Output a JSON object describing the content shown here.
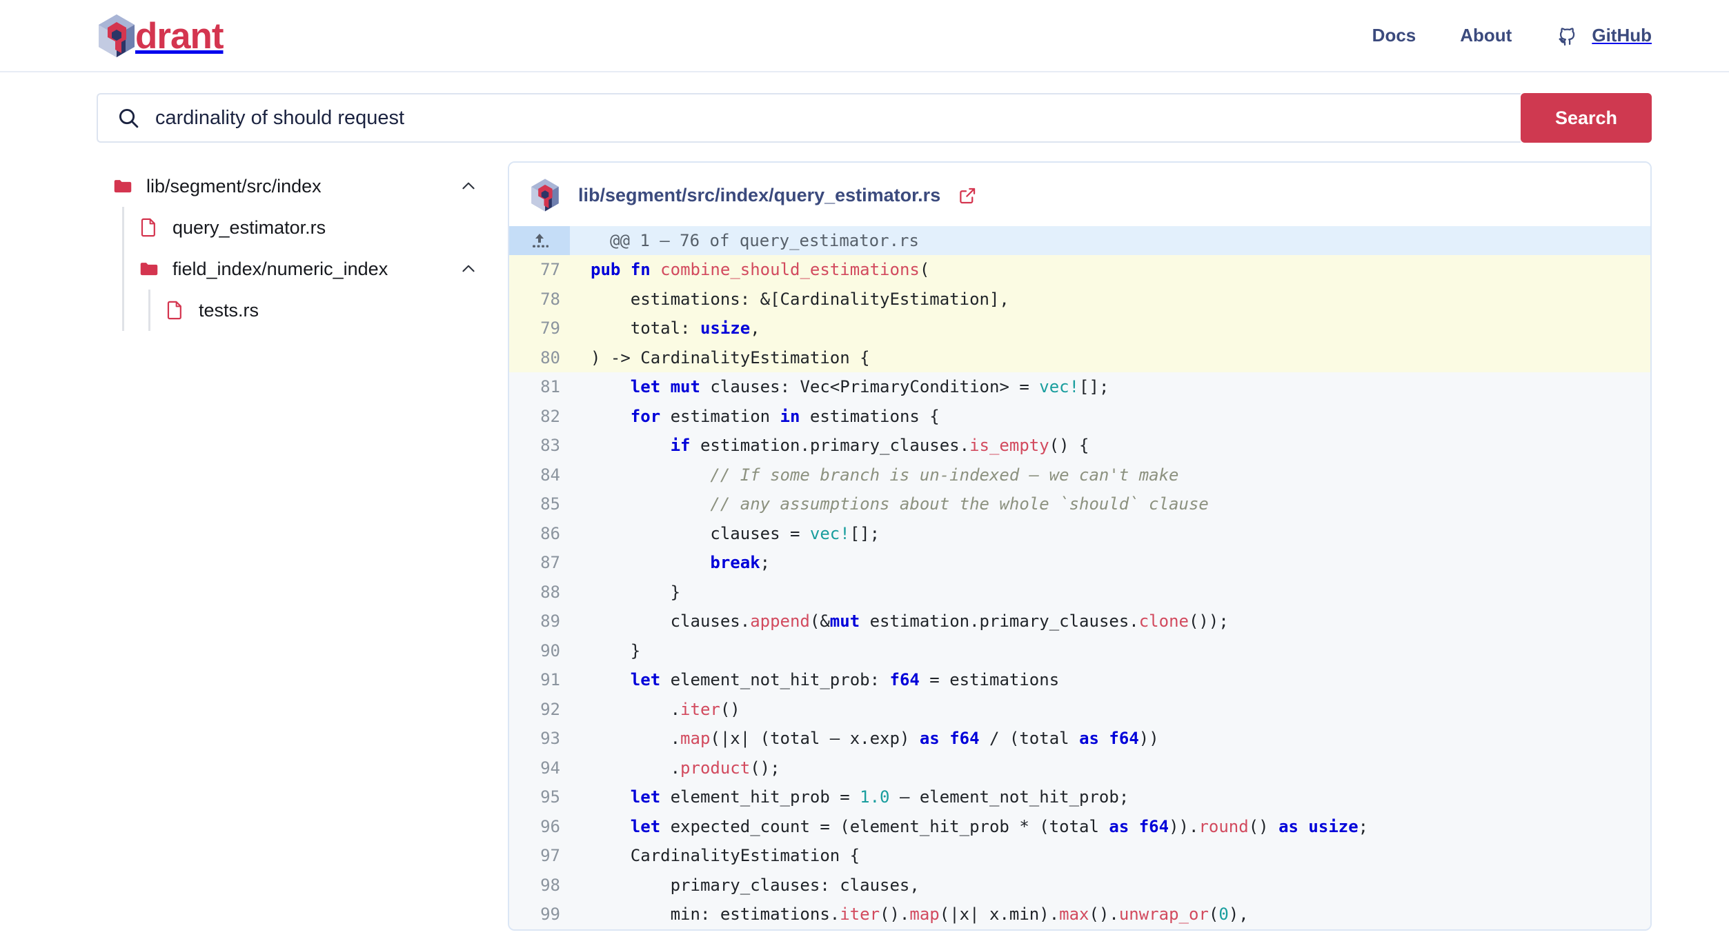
{
  "header": {
    "brand": {
      "word": "drant",
      "logo_icon": "qdrant-logo-icon"
    },
    "nav": [
      {
        "label": "Docs",
        "name": "nav-link-docs"
      },
      {
        "label": "About",
        "name": "nav-link-about"
      },
      {
        "label": "GitHub",
        "name": "nav-link-github",
        "icon": "github-icon"
      }
    ],
    "colors": {
      "brand_red": "#d4354f",
      "nav_navy": "#3b4a7d"
    }
  },
  "search": {
    "icon": "search-icon",
    "value": "cardinality of should request",
    "placeholder": "Search",
    "button_label": "Search",
    "button_color": "#cf3950"
  },
  "sidebar": {
    "items": [
      {
        "label": "lib/segment/src/index",
        "type": "folder",
        "depth": 0,
        "expanded": true,
        "chevron": "chevron-up-icon"
      },
      {
        "label": "query_estimator.rs",
        "type": "file",
        "depth": 1
      },
      {
        "label": "field_index/numeric_index",
        "type": "folder",
        "depth": 1,
        "expanded": true,
        "chevron": "chevron-up-icon"
      },
      {
        "label": "tests.rs",
        "type": "file",
        "depth": 2
      }
    ]
  },
  "result": {
    "logo_icon": "qdrant-logo-icon",
    "path": "lib/segment/src/index/query_estimator.rs",
    "external_link_icon": "external-link-icon",
    "hunk": {
      "icon": "expand-up-icon",
      "text": "@@ 1 – 76 of query_estimator.rs"
    },
    "lines": [
      {
        "n": "77",
        "hl": true,
        "tokens": [
          [
            "k",
            "pub"
          ],
          [
            "p",
            " "
          ],
          [
            "k",
            "fn"
          ],
          [
            "p",
            " "
          ],
          [
            "fn",
            "combine_should_estimations"
          ],
          [
            "p",
            "("
          ]
        ]
      },
      {
        "n": "78",
        "hl": true,
        "tokens": [
          [
            "p",
            "    estimations: &[CardinalityEstimation],"
          ]
        ]
      },
      {
        "n": "79",
        "hl": true,
        "tokens": [
          [
            "p",
            "    total: "
          ],
          [
            "ty",
            "usize"
          ],
          [
            "p",
            ","
          ]
        ]
      },
      {
        "n": "80",
        "hl": true,
        "tokens": [
          [
            "p",
            ") -> CardinalityEstimation {"
          ]
        ]
      },
      {
        "n": "81",
        "hl": false,
        "tokens": [
          [
            "p",
            "    "
          ],
          [
            "k",
            "let"
          ],
          [
            "p",
            " "
          ],
          [
            "k",
            "mut"
          ],
          [
            "p",
            " clauses: Vec<PrimaryCondition> = "
          ],
          [
            "mc",
            "vec!"
          ],
          [
            "p",
            "[];"
          ]
        ]
      },
      {
        "n": "82",
        "hl": false,
        "tokens": [
          [
            "p",
            "    "
          ],
          [
            "k",
            "for"
          ],
          [
            "p",
            " estimation "
          ],
          [
            "k",
            "in"
          ],
          [
            "p",
            " estimations {"
          ]
        ]
      },
      {
        "n": "83",
        "hl": false,
        "tokens": [
          [
            "p",
            "        "
          ],
          [
            "k",
            "if"
          ],
          [
            "p",
            " estimation.primary_clauses."
          ],
          [
            "fn",
            "is_empty"
          ],
          [
            "p",
            "() {"
          ]
        ]
      },
      {
        "n": "84",
        "hl": false,
        "tokens": [
          [
            "p",
            "            "
          ],
          [
            "cm",
            "// If some branch is un-indexed – we can't make"
          ]
        ]
      },
      {
        "n": "85",
        "hl": false,
        "tokens": [
          [
            "p",
            "            "
          ],
          [
            "cm",
            "// any assumptions about the whole `should` clause"
          ]
        ]
      },
      {
        "n": "86",
        "hl": false,
        "tokens": [
          [
            "p",
            "            clauses = "
          ],
          [
            "mc",
            "vec!"
          ],
          [
            "p",
            "[];"
          ]
        ]
      },
      {
        "n": "87",
        "hl": false,
        "tokens": [
          [
            "p",
            "            "
          ],
          [
            "k",
            "break"
          ],
          [
            "p",
            ";"
          ]
        ]
      },
      {
        "n": "88",
        "hl": false,
        "tokens": [
          [
            "p",
            "        }"
          ]
        ]
      },
      {
        "n": "89",
        "hl": false,
        "tokens": [
          [
            "p",
            "        clauses."
          ],
          [
            "fn",
            "append"
          ],
          [
            "p",
            "(&"
          ],
          [
            "k",
            "mut"
          ],
          [
            "p",
            " estimation.primary_clauses."
          ],
          [
            "fn",
            "clone"
          ],
          [
            "p",
            "());"
          ]
        ]
      },
      {
        "n": "90",
        "hl": false,
        "tokens": [
          [
            "p",
            "    }"
          ]
        ]
      },
      {
        "n": "91",
        "hl": false,
        "tokens": [
          [
            "p",
            "    "
          ],
          [
            "k",
            "let"
          ],
          [
            "p",
            " element_not_hit_prob: "
          ],
          [
            "ty",
            "f64"
          ],
          [
            "p",
            " = estimations"
          ]
        ]
      },
      {
        "n": "92",
        "hl": false,
        "tokens": [
          [
            "p",
            "        ."
          ],
          [
            "fn",
            "iter"
          ],
          [
            "p",
            "()"
          ]
        ]
      },
      {
        "n": "93",
        "hl": false,
        "tokens": [
          [
            "p",
            "        ."
          ],
          [
            "fn",
            "map"
          ],
          [
            "p",
            "(|x| (total – x.exp) "
          ],
          [
            "k",
            "as"
          ],
          [
            "p",
            " "
          ],
          [
            "ty",
            "f64"
          ],
          [
            "p",
            " / (total "
          ],
          [
            "k",
            "as"
          ],
          [
            "p",
            " "
          ],
          [
            "ty",
            "f64"
          ],
          [
            "p",
            "))"
          ]
        ]
      },
      {
        "n": "94",
        "hl": false,
        "tokens": [
          [
            "p",
            "        ."
          ],
          [
            "fn",
            "product"
          ],
          [
            "p",
            "();"
          ]
        ]
      },
      {
        "n": "95",
        "hl": false,
        "tokens": [
          [
            "p",
            "    "
          ],
          [
            "k",
            "let"
          ],
          [
            "p",
            " element_hit_prob = "
          ],
          [
            "nu",
            "1.0"
          ],
          [
            "p",
            " – element_not_hit_prob;"
          ]
        ]
      },
      {
        "n": "96",
        "hl": false,
        "tokens": [
          [
            "p",
            "    "
          ],
          [
            "k",
            "let"
          ],
          [
            "p",
            " expected_count = (element_hit_prob * (total "
          ],
          [
            "k",
            "as"
          ],
          [
            "p",
            " "
          ],
          [
            "ty",
            "f64"
          ],
          [
            "p",
            "))."
          ],
          [
            "fn",
            "round"
          ],
          [
            "p",
            "() "
          ],
          [
            "k",
            "as"
          ],
          [
            "p",
            " "
          ],
          [
            "ty",
            "usize"
          ],
          [
            "p",
            ";"
          ]
        ]
      },
      {
        "n": "97",
        "hl": false,
        "tokens": [
          [
            "p",
            "    CardinalityEstimation {"
          ]
        ]
      },
      {
        "n": "98",
        "hl": false,
        "tokens": [
          [
            "p",
            "        primary_clauses: clauses,"
          ]
        ]
      },
      {
        "n": "99",
        "hl": false,
        "tokens": [
          [
            "p",
            "        min: estimations."
          ],
          [
            "fn",
            "iter"
          ],
          [
            "p",
            "()."
          ],
          [
            "fn",
            "map"
          ],
          [
            "p",
            "(|x| x.min)."
          ],
          [
            "fn",
            "max"
          ],
          [
            "p",
            "()."
          ],
          [
            "fn",
            "unwrap_or"
          ],
          [
            "p",
            "("
          ],
          [
            "nu",
            "0"
          ],
          [
            "p",
            "),"
          ]
        ]
      }
    ]
  }
}
